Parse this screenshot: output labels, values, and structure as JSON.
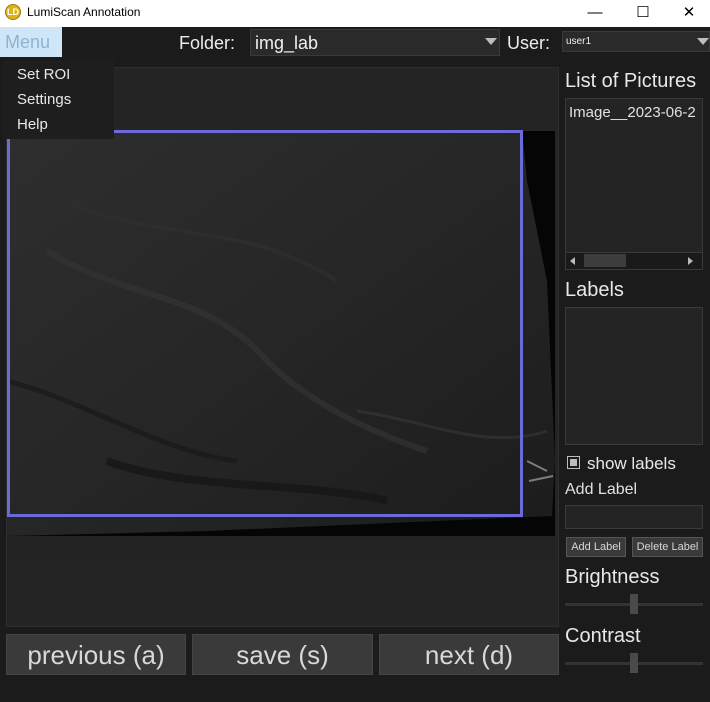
{
  "window": {
    "title": "LumiScan Annotation",
    "icon_text": "LD",
    "minimize": "—",
    "maximize": "☐",
    "close": "✕"
  },
  "topbar": {
    "menu_label": "Menu",
    "folder_label": "Folder:",
    "folder_value": "img_lab",
    "user_label": "User:",
    "user_value": "user1"
  },
  "menu": {
    "items": [
      "Set ROI",
      "Settings",
      "Help"
    ]
  },
  "buttons": {
    "previous": "previous (a)",
    "save": "save (s)",
    "next": "next (d)"
  },
  "right_panel": {
    "pictures_heading": "List of Pictures",
    "pictures": [
      "Image__2023-06-2"
    ],
    "labels_heading": "Labels",
    "show_labels": "show labels",
    "show_labels_checked": true,
    "add_label_heading": "Add Label",
    "add_label_input": "",
    "add_label_button": "Add Label",
    "delete_label_button": "Delete Label",
    "brightness_heading": "Brightness",
    "brightness_level": 0.5,
    "contrast_heading": "Contrast",
    "contrast_level": 0.5
  },
  "colors": {
    "roi": "#6a6ad8",
    "menu_highlight": "#cfe6f8"
  }
}
